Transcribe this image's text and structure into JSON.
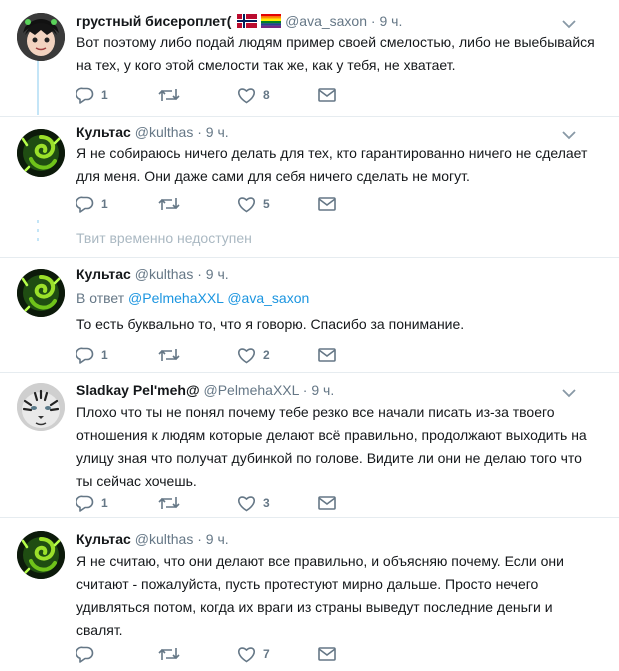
{
  "tweets": [
    {
      "name": "грустный бисероплет(",
      "handle": "@ava_saxon",
      "dot": "·",
      "time": "9 ч.",
      "text": "Вот поэтому либо подай людям пример своей смелостью, либо не выебывайся на тех, у кого этой смелости так же, как у тебя, не хватает.",
      "replies": "1",
      "retweets": "",
      "likes": "8",
      "avatar_icon": "cartoon-avatar"
    },
    {
      "name": "Культас",
      "handle": "@kulthas",
      "dot": "·",
      "time": "9 ч.",
      "text": "Я не собираюсь ничего делать для тех, кто гарантированно ничего не сделает для меня. Они даже сами для себя ничего сделать не могут.",
      "replies": "1",
      "retweets": "",
      "likes": "5",
      "avatar_icon": "green-swirl-avatar"
    },
    {
      "name": "Культас",
      "handle": "@kulthas",
      "dot": "·",
      "time": "9 ч.",
      "reply_prefix": "В ответ",
      "reply_users": [
        "@PelmehaXXL",
        "@ava_saxon"
      ],
      "text": "То есть буквально то, что я говорю. Спасибо за понимание.",
      "replies": "1",
      "retweets": "",
      "likes": "2",
      "avatar_icon": "green-swirl-avatar"
    },
    {
      "name": "Sladkay Pel'meh@",
      "handle": "@PelmehaXXL",
      "dot": "·",
      "time": "9 ч.",
      "text": "Плохо что ты не понял почему тебе резко все начали писать из-за твоего отношения к людям которые делают всё правильно, продолжают выходить на улицу зная что получат дубинкой по голове. Видите ли они не делаю того что ты сейчас хочешь.",
      "replies": "1",
      "retweets": "",
      "likes": "3",
      "avatar_icon": "tiger-avatar"
    },
    {
      "name": "Культас",
      "handle": "@kulthas",
      "dot": "·",
      "time": "9 ч.",
      "text": "Я не считаю, что они делают все правильно, и объясняю почему. Если они считают - пожалуйста, пусть протестуют мирно дальше. Просто нечего удивляться потом, когда их враги из страны выведут последние деньги и свалят.",
      "replies": "",
      "retweets": "",
      "likes": "7",
      "avatar_icon": "green-swirl-avatar"
    }
  ],
  "unavailable_text": "Твит временно недоступен",
  "colors": {
    "text": "#14171a",
    "secondary": "#657786",
    "link": "#1b95e0",
    "thread_line": "#c4e5f7",
    "separator": "#e6ecf0"
  }
}
